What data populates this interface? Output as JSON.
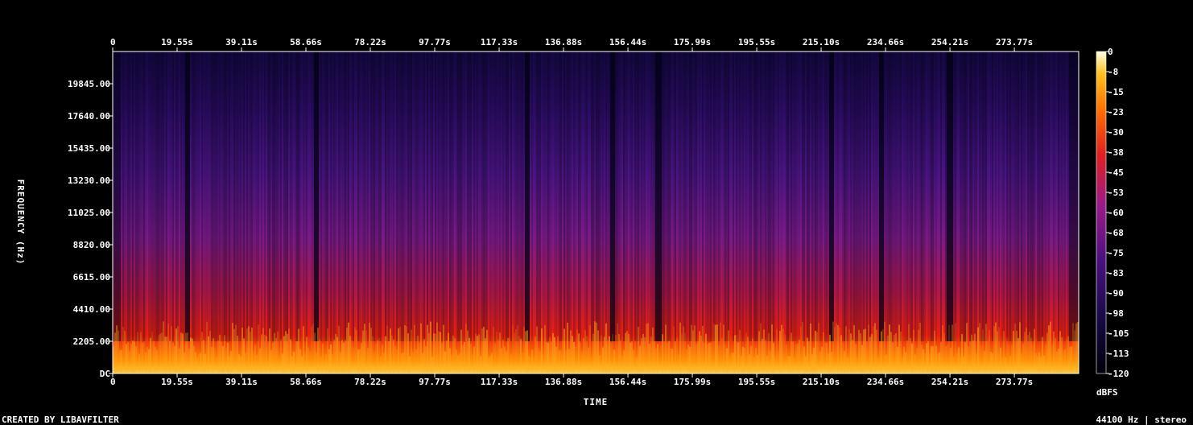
{
  "chart_data": {
    "type": "heatmap",
    "xlabel": "TIME",
    "ylabel": "FREQUENCY (Hz)",
    "x_ticks": [
      "0",
      "19.55s",
      "39.11s",
      "58.66s",
      "78.22s",
      "97.77s",
      "117.33s",
      "136.88s",
      "156.44s",
      "175.99s",
      "195.55s",
      "215.10s",
      "234.66s",
      "254.21s",
      "273.77s"
    ],
    "x_tick_values_s": [
      0,
      19.55,
      39.11,
      58.66,
      78.22,
      97.77,
      117.33,
      136.88,
      156.44,
      175.99,
      195.55,
      215.1,
      234.66,
      254.21,
      273.77
    ],
    "xlim_s": [
      0,
      293.3
    ],
    "y_ticks": [
      "DC",
      "2205.00",
      "4410.00",
      "6615.00",
      "8820.00",
      "11025.00",
      "13230.00",
      "15435.00",
      "17640.00",
      "19845.00"
    ],
    "y_tick_values_hz": [
      0,
      2205,
      4410,
      6615,
      8820,
      11025,
      13230,
      15435,
      17640,
      19845
    ],
    "ylim_hz": [
      0,
      22050
    ],
    "colorbar": {
      "label": "dBFS",
      "ticks": [
        "0",
        "-8",
        "-15",
        "-23",
        "-30",
        "-38",
        "-45",
        "-53",
        "-60",
        "-68",
        "-75",
        "-83",
        "-90",
        "-98",
        "-105",
        "-113",
        "-120"
      ],
      "range_db": [
        -120,
        0
      ]
    },
    "colors": {
      "background": "#000000",
      "map_low": "#000008",
      "map_mid_low": "#3a1070",
      "map_mid": "#9a1a8a",
      "map_mid_high": "#e02010",
      "map_high": "#ff9a00",
      "map_peak": "#ffffd0"
    }
  },
  "footer": {
    "left": "CREATED BY LIBAVFILTER",
    "right": "44100 Hz | stereo"
  }
}
